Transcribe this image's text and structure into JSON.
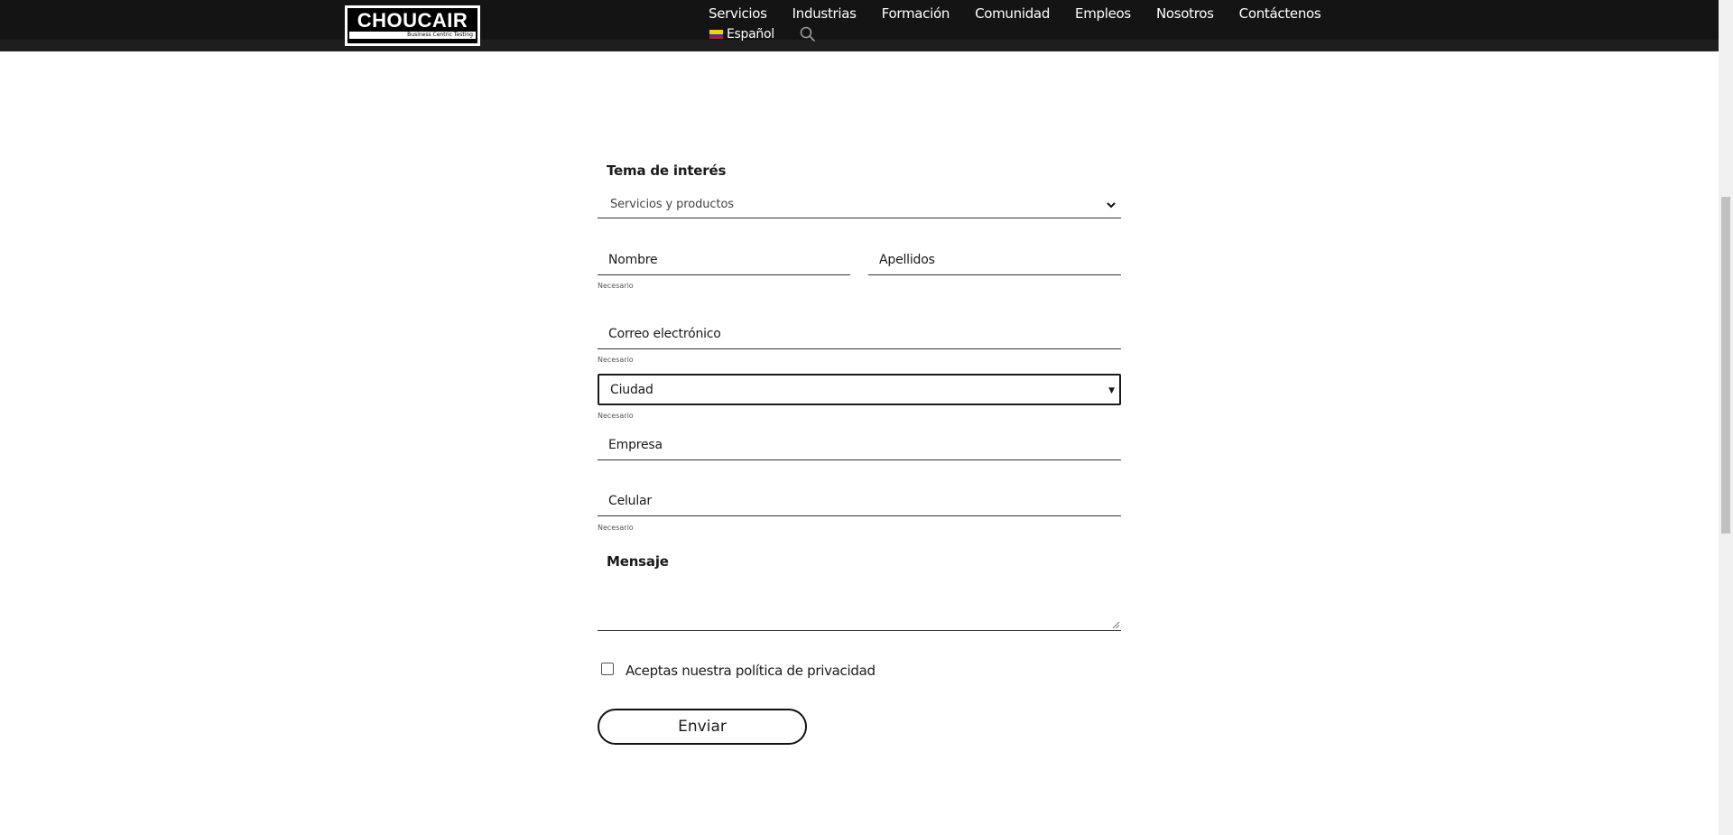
{
  "header": {
    "logo_text": "CHOUCAIR",
    "logo_tagline": "Business Centric Testing",
    "nav": [
      "Servicios",
      "Industrias",
      "Formación",
      "Comunidad",
      "Empleos",
      "Nosotros",
      "Contáctenos"
    ],
    "language": "Español",
    "icons": {
      "search": "search-icon",
      "flag": "colombia-flag-icon"
    },
    "colors": {
      "background": "#141414",
      "text": "#ffffff"
    }
  },
  "form": {
    "topic_label": "Tema de interés",
    "topic_value": "Servicios y productos",
    "first_name": "Nombre",
    "last_name": "Apellidos",
    "required_note": "Necesario",
    "email": "Correo electrónico",
    "city": "Ciudad",
    "company": "Empresa",
    "phone": "Celular",
    "message_label": "Mensaje",
    "privacy_label": "Aceptas nuestra política de privacidad",
    "privacy_checked": false,
    "submit": "Enviar"
  }
}
